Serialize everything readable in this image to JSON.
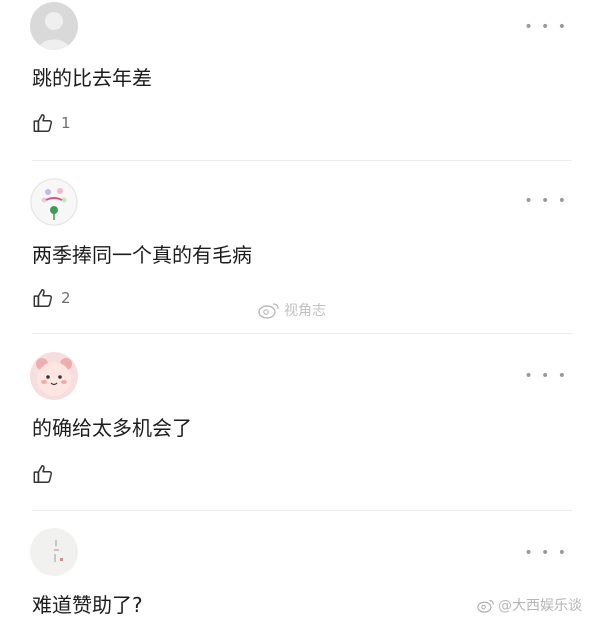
{
  "more_label": "• • •",
  "comments": [
    {
      "text": "跳的比去年差",
      "likes": "1",
      "avatar": "gray-placeholder-avatar"
    },
    {
      "text": "两季捧同一个真的有毛病",
      "likes": "2",
      "avatar": "cartoon-flower-avatar"
    },
    {
      "text": "的确给太多机会了",
      "likes": "",
      "avatar": "pink-bear-avatar"
    },
    {
      "text": "难道赞助了?",
      "likes": "",
      "avatar": "light-calligraphy-avatar"
    }
  ],
  "watermarks": {
    "center": "视角志",
    "corner": "@大西娱乐谈"
  },
  "colors": {
    "text": "#1c1c1c",
    "muted": "#6e6e6e",
    "divider": "#ececec",
    "watermark": "#8c8c8c"
  }
}
